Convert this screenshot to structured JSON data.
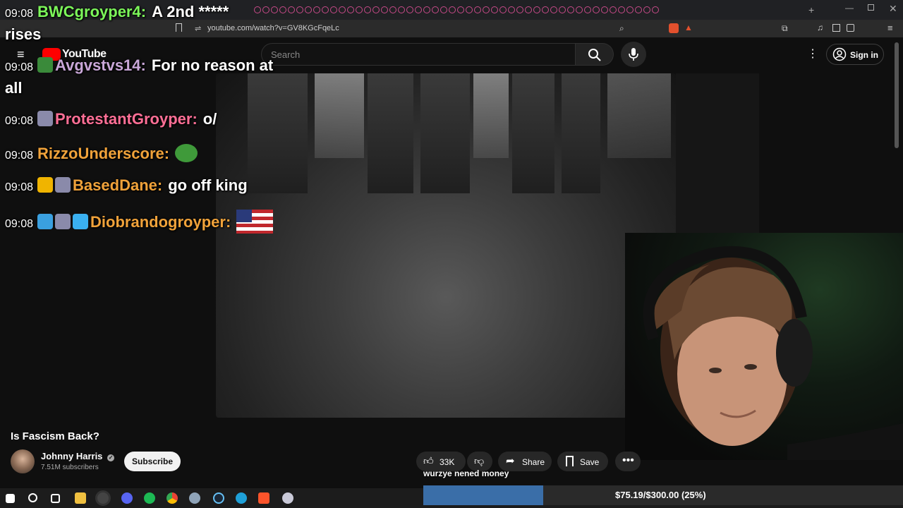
{
  "browser": {
    "url": "youtube.com/watch?v=GV8KGcFqeLc"
  },
  "youtube": {
    "logo_text": "YouTube",
    "search_placeholder": "Search",
    "sign_in_label": "Sign in"
  },
  "chat": [
    {
      "time": "09:08",
      "user": "BWCgroyper4",
      "sep": ":",
      "message": "A 2nd *****",
      "user_color": "#7cf75a"
    },
    {
      "time": "",
      "user": "",
      "sep": "",
      "message": "rises",
      "user_color": "#ffffff"
    },
    {
      "time": "09:08",
      "user": "Avgvstvs14",
      "sep": ":",
      "message": "For no reason at",
      "user_color": "#c9a7d8"
    },
    {
      "time": "",
      "user": "",
      "sep": "",
      "message": "all",
      "user_color": "#ffffff"
    },
    {
      "time": "09:08",
      "user": "ProtestantGroyper",
      "sep": ":",
      "message": "o/",
      "user_color": "#ff6f96"
    },
    {
      "time": "09:08",
      "user": "RizzoUnderscore",
      "sep": ":",
      "message": "",
      "user_color": "#f0a23a"
    },
    {
      "time": "09:08",
      "user": "BasedDane",
      "sep": ":",
      "message": "go off king",
      "user_color": "#f0a23a"
    },
    {
      "time": "09:08",
      "user": "Diobrandogroyper",
      "sep": ":",
      "message": "",
      "user_color": "#f0a23a"
    }
  ],
  "video": {
    "title": "Is Fascism Back?",
    "channel_name": "Johnny Harris",
    "subscribers": "7.51M subscribers",
    "subscribe_label": "Subscribe",
    "likes": "33K",
    "share_label": "Share",
    "save_label": "Save"
  },
  "donation": {
    "message": "wurzye nened money",
    "goal_text": "$75.19/$300.00 (25%)",
    "progress_fraction": 0.25
  },
  "colors": {
    "accent_red": "#ff0000",
    "progress_blue": "#3a6ea8"
  }
}
